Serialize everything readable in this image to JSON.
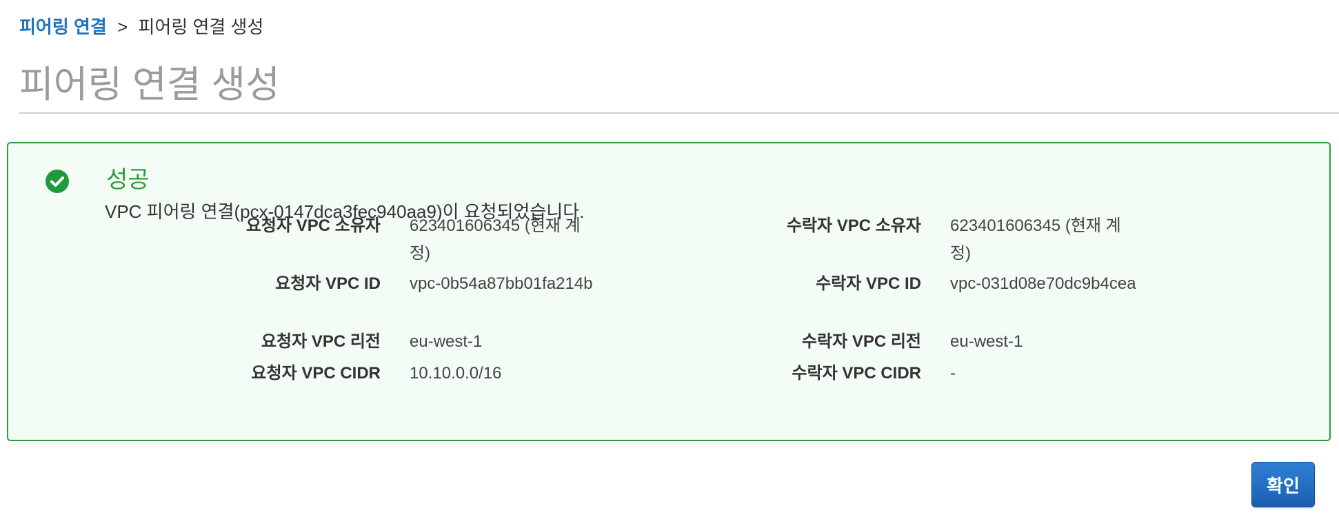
{
  "breadcrumb": {
    "link": "피어링 연결",
    "separator": ">",
    "current": "피어링 연결 생성"
  },
  "page_title": "피어링 연결 생성",
  "alert": {
    "icon": "check-circle-icon",
    "status_color": "#2e9b3c",
    "title": "성공",
    "message": "VPC 피어링 연결(pcx-0147dca3fec940aa9)이 요청되었습니다."
  },
  "requester": {
    "owner_label": "요청자 VPC 소유자",
    "owner_value": "623401606345 (현재 계정)",
    "id_label": "요청자 VPC ID",
    "id_value": "vpc-0b54a87bb01fa214b",
    "region_label": "요청자 VPC 리전",
    "region_value": "eu-west-1",
    "cidr_label": "요청자 VPC CIDR",
    "cidr_value": "10.10.0.0/16"
  },
  "accepter": {
    "owner_label": "수락자 VPC 소유자",
    "owner_value": "623401606345 (현재 계정)",
    "id_label": "수락자 VPC ID",
    "id_value": "vpc-031d08e70dc9b4cea",
    "region_label": "수락자 VPC 리전",
    "region_value": "eu-west-1",
    "cidr_label": "수락자 VPC CIDR",
    "cidr_value": "-"
  },
  "actions": {
    "confirm_label": "확인",
    "accent_color": "#1e73be"
  }
}
